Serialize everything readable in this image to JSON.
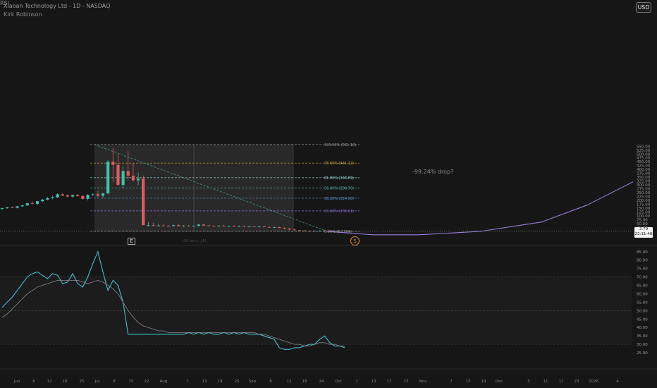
{
  "header": {
    "title": "Xiaoan Technology Ltd - 1D - NASDAQ",
    "subtitle": "Kirk Robinson",
    "currency_button": "USD",
    "rsi_label": "RSI"
  },
  "markers": {
    "earnings": "E",
    "split": "S"
  },
  "annotation": {
    "drop_text": "-99.24% drop?",
    "range_text": "-98 bars, 1M"
  },
  "price_tag": {
    "price": "2.79",
    "countdown": "22:11:48"
  },
  "colors": {
    "background": "#161616",
    "up_candle": "#3fbfb0",
    "down_candle": "#e05c5c",
    "rsi_line": "#3fbfd0",
    "rsi_ma": "#8a8a8a",
    "projection": "#9b7fe0",
    "fib_100": "#9a9a9a",
    "fib_786": "#d4a93a",
    "fib_618": "#8fd1c8",
    "fib_50": "#4db0a8",
    "fib_382": "#5a9ad8",
    "fib_236": "#8b6fd8",
    "fib_0": "#9a9a9a",
    "trendline": "#3fa080",
    "accent_orange": "#e88a1a"
  },
  "chart_data": [
    {
      "type": "candlestick",
      "title": "Xiaoan Technology Ltd - 1D - NASDAQ",
      "ylim": [
        -45,
        600
      ],
      "y_ticks": [
        "550.00",
        "525.00",
        "500.00",
        "475.00",
        "450.00",
        "425.00",
        "400.00",
        "375.00",
        "350.00",
        "325.00",
        "300.00",
        "275.00",
        "250.00",
        "225.00",
        "200.00",
        "175.00",
        "150.00",
        "125.00",
        "100.00",
        "75.00",
        "50.00",
        "25.00",
        "0.00",
        "-25.00"
      ],
      "x_ticks": [
        "Jun",
        "6",
        "12",
        "18",
        "25",
        "Jul",
        "8",
        "15",
        "22",
        "Aug",
        "7",
        "13",
        "19",
        "25",
        "Sep",
        "8",
        "12",
        "18",
        "24",
        "Oct",
        "7",
        "13",
        "17",
        "23",
        "Nov",
        "7",
        "13",
        "19",
        "Dec",
        "5",
        "11",
        "17",
        "23",
        "2026",
        "4"
      ],
      "candles": [
        [
          145,
          152,
          140,
          150
        ],
        [
          150,
          158,
          146,
          155
        ],
        [
          155,
          162,
          150,
          152
        ],
        [
          152,
          165,
          148,
          162
        ],
        [
          162,
          172,
          158,
          168
        ],
        [
          168,
          185,
          164,
          182
        ],
        [
          182,
          195,
          175,
          178
        ],
        [
          178,
          198,
          172,
          195
        ],
        [
          195,
          210,
          188,
          205
        ],
        [
          205,
          222,
          200,
          215
        ],
        [
          215,
          232,
          208,
          220
        ],
        [
          220,
          245,
          214,
          240
        ],
        [
          240,
          248,
          228,
          232
        ],
        [
          232,
          240,
          220,
          225
        ],
        [
          225,
          238,
          215,
          235
        ],
        [
          235,
          242,
          225,
          228
        ],
        [
          228,
          236,
          205,
          210
        ],
        [
          210,
          240,
          200,
          236
        ],
        [
          236,
          245,
          228,
          240
        ],
        [
          240,
          260,
          225,
          230
        ],
        [
          230,
          250,
          215,
          245
        ],
        [
          245,
          460,
          240,
          450
        ],
        [
          450,
          540,
          320,
          430
        ],
        [
          430,
          500,
          300,
          300
        ],
        [
          300,
          420,
          280,
          390
        ],
        [
          390,
          520,
          330,
          360
        ],
        [
          360,
          440,
          320,
          330
        ],
        [
          330,
          380,
          300,
          340
        ],
        [
          340,
          360,
          280,
          40
        ],
        [
          40,
          60,
          30,
          40
        ],
        [
          40,
          55,
          33,
          36
        ],
        [
          36,
          48,
          32,
          38
        ],
        [
          38,
          45,
          33,
          36
        ],
        [
          36,
          42,
          32,
          35
        ],
        [
          35,
          44,
          31,
          40
        ],
        [
          40,
          46,
          33,
          34
        ],
        [
          34,
          40,
          30,
          37
        ],
        [
          37,
          42,
          32,
          33
        ],
        [
          33,
          39,
          30,
          36
        ],
        [
          36,
          50,
          32,
          44
        ],
        [
          44,
          48,
          35,
          38
        ],
        [
          38,
          42,
          33,
          36
        ],
        [
          36,
          40,
          30,
          34
        ],
        [
          34,
          40,
          31,
          37
        ],
        [
          37,
          42,
          32,
          33
        ],
        [
          33,
          38,
          29,
          35
        ],
        [
          35,
          40,
          30,
          32
        ],
        [
          32,
          38,
          28,
          34
        ],
        [
          34,
          38,
          29,
          30
        ],
        [
          30,
          35,
          27,
          32
        ],
        [
          32,
          36,
          27,
          29
        ],
        [
          29,
          34,
          26,
          31
        ],
        [
          31,
          35,
          27,
          28
        ],
        [
          28,
          32,
          24,
          26
        ],
        [
          26,
          30,
          22,
          27
        ],
        [
          27,
          30,
          20,
          22
        ],
        [
          22,
          26,
          15,
          18
        ],
        [
          18,
          22,
          10,
          12
        ],
        [
          12,
          15,
          5,
          8
        ],
        [
          8,
          10,
          3,
          6
        ],
        [
          6,
          8,
          2,
          4
        ],
        [
          4,
          6,
          1,
          3
        ],
        [
          3,
          5,
          1,
          4
        ],
        [
          4,
          6,
          2,
          5
        ],
        [
          5,
          6,
          1,
          3
        ],
        [
          3,
          4,
          1,
          2.79
        ]
      ],
      "fib_levels": [
        {
          "label": "100.00% (561.16)",
          "value": 561.16
        },
        {
          "label": "78.60% (441.12)",
          "value": 441.12
        },
        {
          "label": "61.80% (346.89)",
          "value": 346.89
        },
        {
          "label": "50.00% (280.70)",
          "value": 280.7
        },
        {
          "label": "38.20% (214.50)",
          "value": 214.5
        },
        {
          "label": "23.60% (132.61)",
          "value": 132.61
        },
        {
          "label": "0.00% (0.2764)",
          "value": 0.2764
        }
      ],
      "projection_curve": [
        {
          "x": 0,
          "y": 0.27
        },
        {
          "x": 0.15,
          "y": -22
        },
        {
          "x": 0.3,
          "y": -22
        },
        {
          "x": 0.5,
          "y": 0
        },
        {
          "x": 0.7,
          "y": 60
        },
        {
          "x": 0.85,
          "y": 170
        },
        {
          "x": 1,
          "y": 320
        }
      ],
      "current_price": 2.79
    },
    {
      "type": "line",
      "title": "RSI",
      "ylim": [
        20,
        87
      ],
      "y_ticks": [
        "85.00",
        "80.00",
        "75.00",
        "70.00",
        "65.00",
        "60.00",
        "55.00",
        "50.00",
        "45.00",
        "40.00",
        "35.00",
        "30.00",
        "25.00"
      ],
      "reference_lines": [
        70,
        50,
        30
      ],
      "series": [
        {
          "values": [
            52,
            55,
            58,
            62,
            66,
            70,
            72,
            73,
            71,
            69,
            72,
            71,
            66,
            67,
            72,
            66,
            64,
            70,
            78,
            85,
            73,
            62,
            68,
            65,
            55,
            36,
            36,
            36,
            36,
            36,
            36,
            36,
            36,
            36,
            36,
            36,
            36,
            37,
            36,
            37,
            36,
            37,
            36,
            36,
            37,
            36,
            37,
            36,
            37,
            36,
            36,
            36,
            35,
            34,
            33,
            28,
            27,
            27,
            28,
            28,
            29,
            30,
            30,
            33,
            35,
            31,
            29,
            29,
            28
          ]
        },
        {
          "values": [
            46,
            48,
            51,
            54,
            57,
            60,
            62,
            64,
            65,
            66,
            67,
            68,
            68,
            68,
            68,
            68,
            67,
            66,
            67,
            68,
            67,
            65,
            63,
            60,
            55,
            50,
            46,
            43,
            41,
            40,
            39,
            38,
            38,
            37,
            37,
            37,
            37,
            37,
            37,
            37,
            37,
            37,
            37,
            37,
            37,
            37,
            37,
            37,
            37,
            37,
            37,
            36,
            36,
            35,
            34,
            33,
            32,
            31,
            30,
            30,
            29,
            29,
            30,
            31,
            31,
            30,
            30,
            29,
            29
          ]
        }
      ]
    }
  ]
}
